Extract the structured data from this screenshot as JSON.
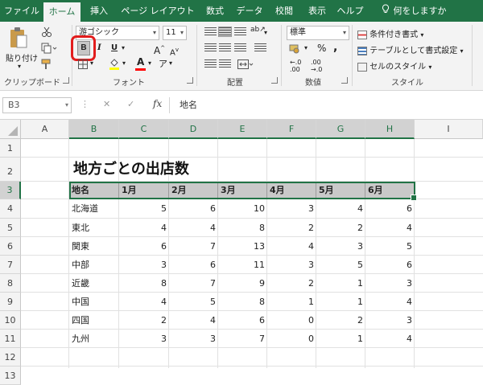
{
  "tabs": [
    {
      "label": "ファイル",
      "active": false
    },
    {
      "label": "ホーム",
      "active": true
    },
    {
      "label": "挿入",
      "active": false
    },
    {
      "label": "ページ レイアウト",
      "active": false
    },
    {
      "label": "数式",
      "active": false
    },
    {
      "label": "データ",
      "active": false
    },
    {
      "label": "校閲",
      "active": false
    },
    {
      "label": "表示",
      "active": false
    },
    {
      "label": "ヘルプ",
      "active": false
    },
    {
      "label": "何をしますか",
      "active": false
    }
  ],
  "ribbon": {
    "clipboard": {
      "paste_label": "貼り付け",
      "group_label": "クリップボード"
    },
    "font": {
      "font_name": "游ゴシック",
      "font_size": "11",
      "bold_label": "B",
      "italic_label": "I",
      "underline_label": "U",
      "grow_label": "A",
      "shrink_label": "A",
      "font_color_label": "A",
      "group_label": "フォント"
    },
    "alignment": {
      "group_label": "配置"
    },
    "number": {
      "format": "標準",
      "percent_label": "%",
      "comma_label": ",",
      "group_label": "数値"
    },
    "styles": {
      "conditional_label": "条件付き書式",
      "table_label": "テーブルとして書式設定",
      "cell_styles_label": "セルのスタイル",
      "group_label": "スタイル"
    }
  },
  "formula_bar": {
    "name_box": "B3",
    "fx_label": "fx",
    "content": "地名"
  },
  "columns": [
    "A",
    "B",
    "C",
    "D",
    "E",
    "F",
    "G",
    "H",
    "I"
  ],
  "rows": [
    "1",
    "2",
    "3",
    "4",
    "5",
    "6",
    "7",
    "8",
    "9",
    "10",
    "11",
    "12",
    "13"
  ],
  "sheet": {
    "title": "地方ごとの出店数",
    "header": [
      "地名",
      "1月",
      "2月",
      "3月",
      "4月",
      "5月",
      "6月"
    ],
    "data": [
      {
        "name": "北海道",
        "values": [
          "5",
          "6",
          "10",
          "3",
          "4",
          "6"
        ]
      },
      {
        "name": "東北",
        "values": [
          "4",
          "4",
          "8",
          "2",
          "2",
          "4"
        ]
      },
      {
        "name": "関東",
        "values": [
          "6",
          "7",
          "13",
          "4",
          "3",
          "5"
        ]
      },
      {
        "name": "中部",
        "values": [
          "3",
          "6",
          "11",
          "3",
          "5",
          "6"
        ]
      },
      {
        "name": "近畿",
        "values": [
          "8",
          "7",
          "9",
          "2",
          "1",
          "3"
        ]
      },
      {
        "name": "中国",
        "values": [
          "4",
          "5",
          "8",
          "1",
          "1",
          "4"
        ]
      },
      {
        "name": "四国",
        "values": [
          "2",
          "4",
          "6",
          "0",
          "2",
          "3"
        ]
      },
      {
        "name": "九州",
        "values": [
          "3",
          "3",
          "7",
          "0",
          "1",
          "4"
        ]
      }
    ]
  },
  "colors": {
    "accent": "#217346",
    "highlight": "#e21d1d",
    "font_color_bar": "#ff0000"
  }
}
